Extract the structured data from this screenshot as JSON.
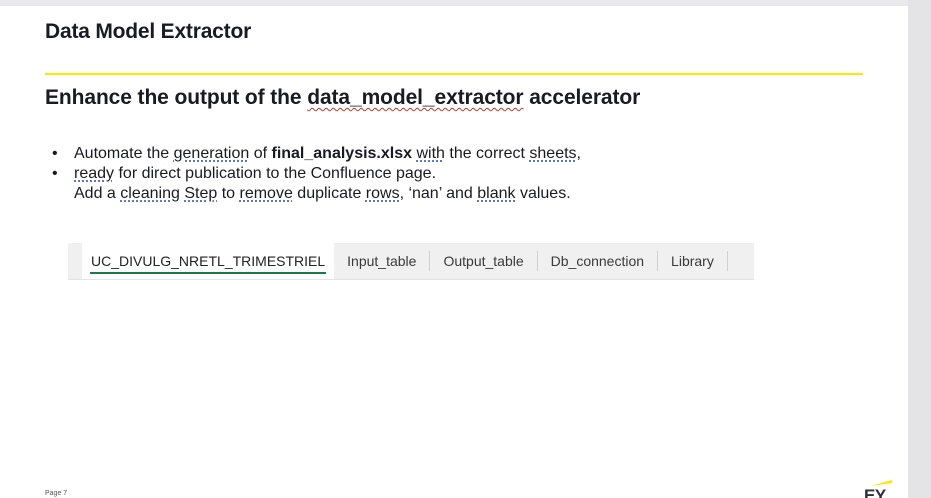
{
  "slide": {
    "title": "Data Model Extractor",
    "subtitle_prefix": "Enhance the output of the ",
    "subtitle_code": "data_model_extractor",
    "subtitle_suffix": " accelerator",
    "bullets": {
      "b1_part1": "Automate the ",
      "b1_generation": "generation",
      "b1_part2": " of ",
      "b1_file": "final_analysis.xlsx",
      "b1_space": " ",
      "b1_with": "with",
      "b1_part3": " the correct ",
      "b1_sheets": "sheets",
      "b1_part4": ",",
      "b2_ready": "ready",
      "b2_part1": " for direct publication to the Confluence page.",
      "b3_part1": "Add a ",
      "b3_cleaning": "cleaning",
      "b3_space1": " ",
      "b3_step": "Step",
      "b3_part2": " to ",
      "b3_remove": "remove",
      "b3_part3": " duplicate ",
      "b3_rows": "rows",
      "b3_part4": ", ‘nan’ and ",
      "b3_blank": "blank",
      "b3_part5": " values."
    },
    "tabs": [
      {
        "label": "UC_DIVULG_NRETL_TRIMESTRIEL",
        "active": true
      },
      {
        "label": "Input_table",
        "active": false
      },
      {
        "label": "Output_table",
        "active": false
      },
      {
        "label": "Db_connection",
        "active": false
      },
      {
        "label": "Library",
        "active": false
      }
    ],
    "footer_page": "Page 7",
    "logo_text": "EY"
  },
  "colors": {
    "accent_yellow": "#ffe600",
    "active_tab_underline": "#1e7a45",
    "text": "#1a1a24"
  }
}
